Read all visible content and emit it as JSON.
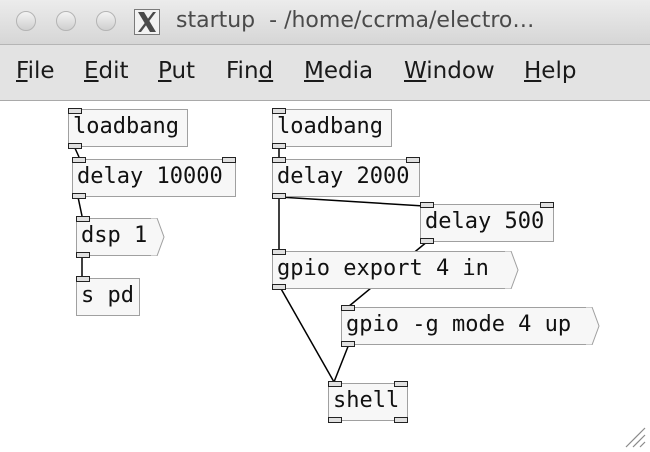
{
  "window": {
    "title": "startup  - /home/ccrma/electro…",
    "buttons": [
      "close",
      "minimize",
      "zoom"
    ],
    "app_icon": "x11-icon"
  },
  "menu": {
    "items": [
      {
        "label": "File",
        "mnemonic": 0
      },
      {
        "label": "Edit",
        "mnemonic": 0
      },
      {
        "label": "Put",
        "mnemonic": 0
      },
      {
        "label": "Find",
        "mnemonic": 3
      },
      {
        "label": "Media",
        "mnemonic": 0
      },
      {
        "label": "Window",
        "mnemonic": 0
      },
      {
        "label": "Help",
        "mnemonic": 0
      }
    ]
  },
  "patch": {
    "objects": {
      "loadbang_1": "loadbang",
      "delay_10000": "delay 10000",
      "dsp_1": "dsp 1",
      "s_pd": "s pd",
      "loadbang_2": "loadbang",
      "delay_2000": "delay 2000",
      "delay_500": "delay 500",
      "gpio_export": "gpio export 4 in",
      "gpio_mode": "gpio -g mode 4 up",
      "shell": "shell"
    }
  },
  "colors": {
    "object_fill": "#f7f7f7",
    "object_border": "#a0a0a0",
    "wire": "#000000",
    "menubar": "#e3e3e3"
  }
}
